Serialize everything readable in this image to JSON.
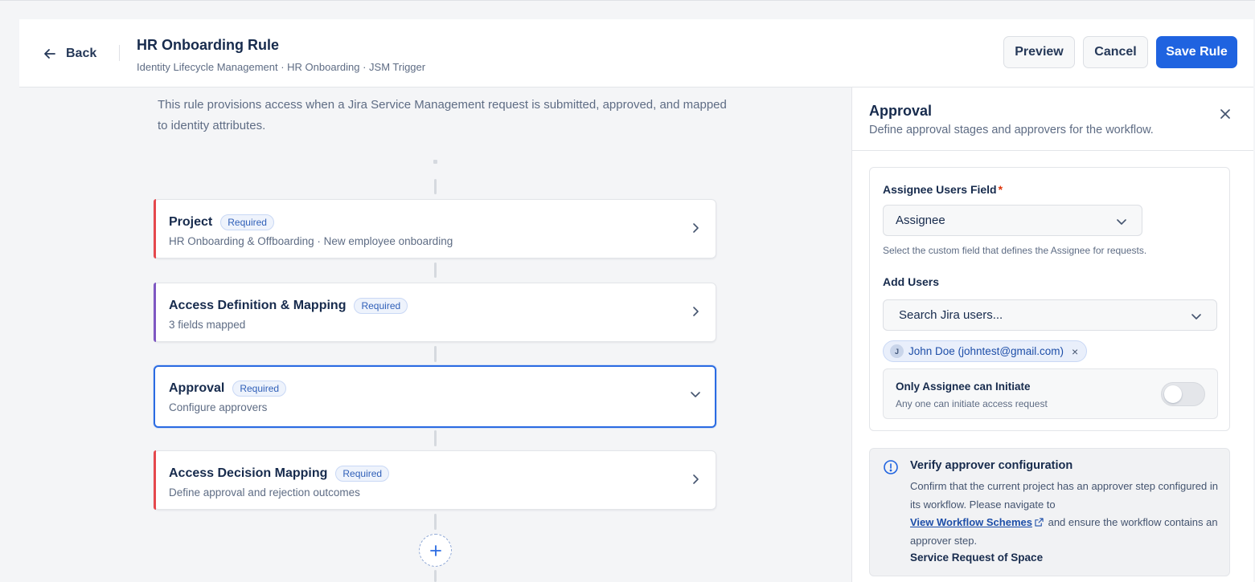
{
  "header": {
    "back_label": "Back",
    "title": "HR Onboarding Rule",
    "breadcrumbs": "Identity Lifecycle Management · HR Onboarding · JSM Trigger",
    "preview_label": "Preview",
    "cancel_label": "Cancel",
    "save_label": "Save Rule"
  },
  "intro_text": "This rule provisions access when a Jira Service Management request is submitted, approved, and mapped to identity attributes.",
  "steps": [
    {
      "title": "Project",
      "badge": "Required",
      "subtitle": "HR Onboarding & Offboarding · New employee onboarding",
      "accent": "#e5484d",
      "state": "collapsed"
    },
    {
      "title": "Access Definition & Mapping",
      "badge": "Required",
      "subtitle": "3 fields mapped",
      "accent": "#7e57c2",
      "state": "collapsed"
    },
    {
      "title": "Approval",
      "badge": "Required",
      "subtitle": "Configure approvers",
      "accent": "#2a6be2",
      "state": "active"
    },
    {
      "title": "Access Decision Mapping",
      "badge": "Required",
      "subtitle": "Define approval and rejection outcomes",
      "accent": "#e5484d",
      "state": "collapsed"
    }
  ],
  "panel": {
    "title": "Approval",
    "subtitle": "Define approval stages and approvers for the workflow.",
    "assignee_field": {
      "label": "Assignee Users Field",
      "required_mark": "*",
      "selected": "Assignee",
      "help": "Select the custom field that defines the Assignee for requests."
    },
    "add_users": {
      "label": "Add Users",
      "placeholder": "Search Jira users...",
      "chips": [
        {
          "initial": "J",
          "label": "John Doe (johntest@gmail.com)",
          "remove": "×"
        }
      ]
    },
    "toggle": {
      "label": "Only Assignee can Initiate",
      "description": "Any one can initiate access request",
      "enabled": false
    },
    "info": {
      "title": "Verify approver configuration",
      "body_before": "Confirm that the current project has an approver step configured in its workflow. Please navigate to",
      "link": "View Workflow Schemes",
      "body_after": "and ensure the workflow contains an approver step.",
      "footer": "Service Request of Space"
    }
  },
  "colors": {
    "primary": "#1f63e0",
    "active_border": "#2a6be2",
    "badge_text": "#2f5fb8",
    "required": "#de350b"
  }
}
